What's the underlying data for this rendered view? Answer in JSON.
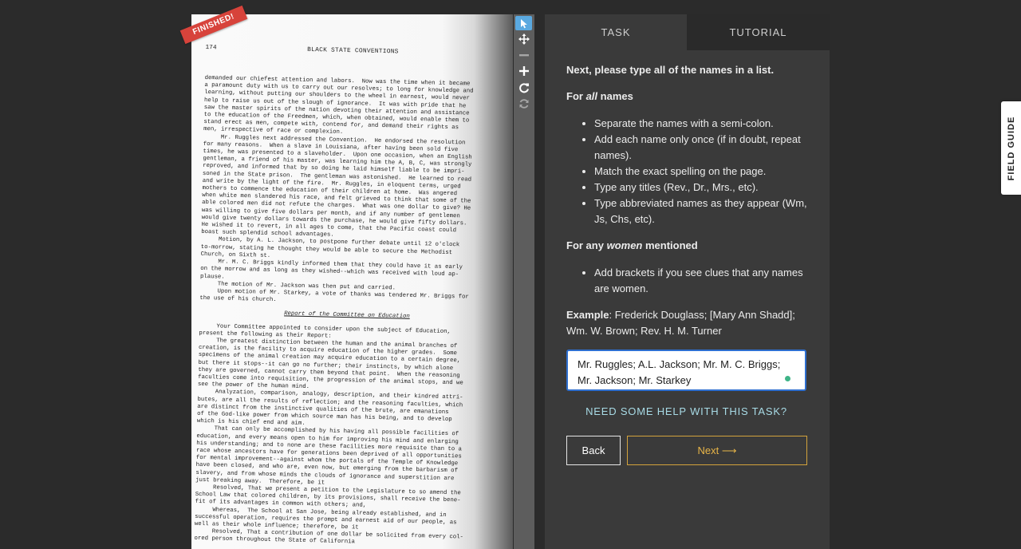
{
  "document": {
    "page_number": "174",
    "running_title": "BLACK STATE CONVENTIONS",
    "status_ribbon": "FINISHED!",
    "lines": [
      {
        "t": "demanded our chiefest attention and labors.  Now was the time when it became",
        "c": ""
      },
      {
        "t": "a paramount duty with us to carry out our resolves; to long for knowledge and",
        "c": ""
      },
      {
        "t": "learning, without putting our shoulders to the wheel in earnest, would never",
        "c": ""
      },
      {
        "t": "help to raise us out of the slough of ignorance.  It was with pride that he",
        "c": ""
      },
      {
        "t": "saw the master spirits of the nation devoting their attention and assistance",
        "c": ""
      },
      {
        "t": "to the education of the Freedmen, which, when obtained, would enable them to",
        "c": ""
      },
      {
        "t": "stand erect as men, compete with, contend for, and demand their rights as",
        "c": ""
      },
      {
        "t": "men, irrespective of race or complexion.",
        "c": ""
      },
      {
        "t": "Mr. Ruggles next addressed the Convention.  He endorsed the resolution",
        "c": "ind"
      },
      {
        "t": "for many reasons.  When a slave in Louisiana, after having been sold five",
        "c": ""
      },
      {
        "t": "times, he was presented to a slaveholder.  Upon one occasion, when an English",
        "c": ""
      },
      {
        "t": "gentleman, a friend of his master, was learning him the A, B, C, was strongly",
        "c": ""
      },
      {
        "t": "reproved, and informed that by so doing he laid himself liable to be impri-",
        "c": ""
      },
      {
        "t": "soned in the State prison.  The gentleman was astonished.  He learned to read",
        "c": ""
      },
      {
        "t": "and write by the light of the fire.  Mr. Ruggles, in eloquent terms, urged",
        "c": ""
      },
      {
        "t": "mothers to commence the education of their children at home.  Was angered",
        "c": ""
      },
      {
        "t": "when white men slandered his race, and felt grieved to think that some of the",
        "c": ""
      },
      {
        "t": "able colored men did not refute the charges.  What was one dollar to give? He",
        "c": ""
      },
      {
        "t": "was willing to give five dollars per month, and if any number of gentlemen",
        "c": ""
      },
      {
        "t": "would give twenty dollars towards the purchase, he would give fifty dollars.",
        "c": ""
      },
      {
        "t": "He wished it to revert, in all ages to come, that the Pacific coast could",
        "c": ""
      },
      {
        "t": "boast such splendid school advantages.",
        "c": ""
      },
      {
        "t": "Motion, by A. L. Jackson, to postpone further debate until 12 o'clock",
        "c": "ind"
      },
      {
        "t": "to-morrow, stating he thought they would be able to secure the Methodist",
        "c": ""
      },
      {
        "t": "Church, on Sixth st.",
        "c": ""
      },
      {
        "t": "Mr. M. C. Briggs kindly informed them that they could have it as early",
        "c": "ind"
      },
      {
        "t": "on the morrow and as long as they wished--which was received with loud ap-",
        "c": ""
      },
      {
        "t": "plause.",
        "c": ""
      },
      {
        "t": "The motion of Mr. Jackson was then put and carried.",
        "c": "ind"
      },
      {
        "t": "Upon motion of Mr. Starkey, a vote of thanks was tendered Mr. Briggs for",
        "c": "ind"
      },
      {
        "t": "the use of his church.",
        "c": ""
      },
      {
        "t": "Report of the Committee on Education",
        "c": "sec"
      },
      {
        "t": "Your Committee appointed to consider upon the subject of Education,",
        "c": "ind"
      },
      {
        "t": "present the following as their Report:",
        "c": ""
      },
      {
        "t": "The greatest distinction between the human and the animal branches of",
        "c": "ind"
      },
      {
        "t": "creation, is the facility to acquire education of the higher grades.  Some",
        "c": ""
      },
      {
        "t": "specimens of the animal creation may acquire education to a certain degree,",
        "c": ""
      },
      {
        "t": "but there it stops--it can go no further; their instincts, by which alone",
        "c": ""
      },
      {
        "t": "they are governed, cannot carry them beyond that point.  When the reasoning",
        "c": ""
      },
      {
        "t": "faculties come into requisition, the progression of the animal stops, and we",
        "c": ""
      },
      {
        "t": "see the power of the human mind.",
        "c": ""
      },
      {
        "t": "Analyzation, comparison, analogy, description, and their kindred attri-",
        "c": "ind"
      },
      {
        "t": "butes, are all the results of reflection; and the reasoning faculties, which",
        "c": ""
      },
      {
        "t": "are distinct from the instinctive qualities of the brute, are emanations",
        "c": ""
      },
      {
        "t": "of the God-like power from which source man has his being, and to develop",
        "c": ""
      },
      {
        "t": "which is his chief end and aim.",
        "c": ""
      },
      {
        "t": "That can only be accomplished by his having all possible facilities of",
        "c": "ind"
      },
      {
        "t": "education, and every means open to him for improving his mind and enlarging",
        "c": ""
      },
      {
        "t": "his understanding; and to none are these facilities more requisite than to a",
        "c": ""
      },
      {
        "t": "race whose ancestors have for generations been deprived of all opportunities",
        "c": ""
      },
      {
        "t": "for mental improvement--against whom the portals of the Temple of Knowledge",
        "c": ""
      },
      {
        "t": "have been closed, and who are, even now, but emerging from the barbarism of",
        "c": ""
      },
      {
        "t": "slavery, and from whose minds the clouds of ignorance and superstition are",
        "c": ""
      },
      {
        "t": "just breaking away.  Therefore, be it",
        "c": ""
      },
      {
        "t": "Resolved, That we present a petition to the Legislature to so amend the",
        "c": "ind"
      },
      {
        "t": "School Law that colored children, by its provisions, shall receive the bene-",
        "c": ""
      },
      {
        "t": "fit of its advantages in common with others; and,",
        "c": ""
      },
      {
        "t": "Whereas,  The School at San Jose, being already established, and in",
        "c": "ind"
      },
      {
        "t": "successful operation, requires the prompt and earnest aid of our people, as",
        "c": ""
      },
      {
        "t": "well as their whole influence; therefore, be it",
        "c": ""
      },
      {
        "t": "Resolved, That a contribution of one dollar be solicited from every col-",
        "c": "ind"
      },
      {
        "t": "ored person throughout the State of California",
        "c": ""
      }
    ]
  },
  "toolbar": {
    "tools": [
      {
        "name": "pointer-icon",
        "state": "active"
      },
      {
        "name": "move-icon",
        "state": "normal"
      },
      {
        "name": "zoom-out-icon",
        "state": "dim"
      },
      {
        "name": "zoom-in-icon",
        "state": "normal"
      },
      {
        "name": "rotate-icon",
        "state": "normal"
      },
      {
        "name": "reset-icon",
        "state": "dim"
      }
    ]
  },
  "tabs": {
    "task": "TASK",
    "tutorial": "TUTORIAL"
  },
  "task": {
    "instruction": "Next, please type all of the names in a list.",
    "group1": {
      "prefix": "For ",
      "em": "all",
      "suffix": " names"
    },
    "rules1": [
      "Separate the names with a semi-colon.",
      "Add each name only once (if in doubt, repeat names).",
      "Match the exact spelling on the page.",
      "Type any titles (Rev., Dr., Mrs., etc).",
      "Type abbreviated names as they appear (Wm, Js, Chs, etc)."
    ],
    "group2": {
      "prefix": "For any ",
      "em": "women",
      "suffix": " mentioned"
    },
    "rules2": [
      "Add brackets if you see clues that any names are women."
    ],
    "example_label": "Example",
    "example_text": ": Frederick Douglass; [Mary Ann Shadd]; Wm. W. Brown; Rev. H. M. Turner",
    "answer_value": "Mr. Ruggles; A.L. Jackson; Mr. M. C. Briggs; Mr. Jackson; Mr. Starkey",
    "help_link": "NEED SOME HELP WITH THIS TASK?",
    "back_label": "Back",
    "next_label": "Next ⟶"
  },
  "field_guide": {
    "label": "FIELD GUIDE"
  },
  "colors": {
    "background": "#2b2b2b",
    "panel": "#3a3a3a",
    "tab_inactive": "#2a2a2a",
    "ribbon": "#d7433b",
    "tool_active": "#5aa9e0",
    "input_border": "#2e6fd0",
    "help_link": "#a8dbe6",
    "next_accent": "#e8b548",
    "spellcheck_dot": "#3fb487"
  }
}
